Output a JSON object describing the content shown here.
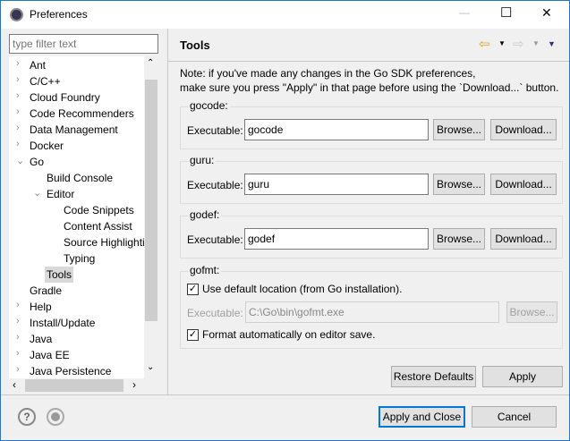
{
  "window": {
    "title": "Preferences",
    "minimize": "—",
    "maximize": "☐",
    "close": "✕"
  },
  "filter": {
    "placeholder": "type filter text"
  },
  "tree": [
    {
      "label": "Ant",
      "level": 0,
      "arrow": "›"
    },
    {
      "label": "C/C++",
      "level": 0,
      "arrow": "›"
    },
    {
      "label": "Cloud Foundry",
      "level": 0,
      "arrow": "›"
    },
    {
      "label": "Code Recommenders",
      "level": 0,
      "arrow": "›"
    },
    {
      "label": "Data Management",
      "level": 0,
      "arrow": "›"
    },
    {
      "label": "Docker",
      "level": 0,
      "arrow": "›"
    },
    {
      "label": "Go",
      "level": 0,
      "arrow": "⌄"
    },
    {
      "label": "Build Console",
      "level": 1,
      "arrow": ""
    },
    {
      "label": "Editor",
      "level": 1,
      "arrow": "⌄"
    },
    {
      "label": "Code Snippets",
      "level": 2,
      "arrow": ""
    },
    {
      "label": "Content Assist",
      "level": 2,
      "arrow": ""
    },
    {
      "label": "Source Highlighting",
      "level": 2,
      "arrow": ""
    },
    {
      "label": "Typing",
      "level": 2,
      "arrow": ""
    },
    {
      "label": "Tools",
      "level": 1,
      "arrow": "",
      "selected": true
    },
    {
      "label": "Gradle",
      "level": 0,
      "arrow": ""
    },
    {
      "label": "Help",
      "level": 0,
      "arrow": "›"
    },
    {
      "label": "Install/Update",
      "level": 0,
      "arrow": "›"
    },
    {
      "label": "Java",
      "level": 0,
      "arrow": "›"
    },
    {
      "label": "Java EE",
      "level": 0,
      "arrow": "›"
    },
    {
      "label": "Java Persistence",
      "level": 0,
      "arrow": "›"
    }
  ],
  "page": {
    "title": "Tools",
    "note1": "Note: if you've made any changes in the Go SDK preferences,",
    "note2": "make sure you press \"Apply\" in that page before using the `Download...` button.",
    "groups": [
      {
        "label": "gocode:",
        "exec_label": "Executable:",
        "value": "gocode",
        "browse": "Browse...",
        "download": "Download..."
      },
      {
        "label": "guru:",
        "exec_label": "Executable:",
        "value": "guru",
        "browse": "Browse...",
        "download": "Download..."
      },
      {
        "label": "godef:",
        "exec_label": "Executable:",
        "value": "godef",
        "browse": "Browse...",
        "download": "Download..."
      }
    ],
    "gofmt": {
      "label": "gofmt:",
      "use_default": "Use default location (from Go installation).",
      "exec_label": "Executable:",
      "value": "C:\\Go\\bin\\gofmt.exe",
      "browse": "Browse...",
      "format_auto": "Format automatically on editor save.",
      "check": "✓"
    },
    "restore": "Restore Defaults",
    "apply": "Apply"
  },
  "footer": {
    "apply_close": "Apply and Close",
    "cancel": "Cancel",
    "help": "?"
  }
}
